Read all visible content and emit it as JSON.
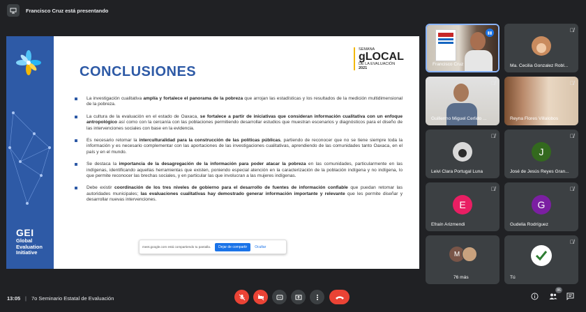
{
  "topbar": {
    "presenter": "Francisco Cruz está presentando"
  },
  "slide": {
    "title": "CONCLUSIONES",
    "brand": {
      "line1": "SEMANA",
      "line2": "gLOCAL",
      "line3": "DE LA EVALUACIÓN",
      "line4": "2021"
    },
    "logo": {
      "big": "GEI",
      "line1": "Global",
      "line2": "Evaluation",
      "line3": "Initiative"
    },
    "bullets": [
      {
        "a": "La investigación cualitativa ",
        "b": "amplía y fortalece el panorama de la pobreza",
        "c": " que arrojan las estadísticas y los resultados de la medición multidimensional de la pobreza.",
        "d": "",
        "e": ""
      },
      {
        "a": "La cultura de la evaluación en el estado de Oaxaca, ",
        "b": "se fortalece a partir de iniciativas que consideran información cualitativa con un enfoque antropológico",
        "c": " así como con la cercanía con las poblaciones permitiendo desarrollar estudios que muestran escenarios y diagnósticos para el diseño de las intervenciones sociales con base en la evidencia.",
        "d": "",
        "e": ""
      },
      {
        "a": "Es necesario retomar la ",
        "b": "interculturalidad para la construcción de las políticas públicas",
        "c": ", partiendo de reconocer que no se tiene siempre toda la información y es necesario complementar con las aportaciones de las investigaciones cualitativas, aprendiendo de las comunidades tanto Oaxaca, en el país y en el mundo.",
        "d": "",
        "e": ""
      },
      {
        "a": "Se destaca la ",
        "b": "importancia de la desagregación de la información para poder atacar la pobreza",
        "c": " en las comunidades, particularmente en las indígenas, identificando aquellas herramientas que existen, poniendo especial atención en la caracterización de la población indígena y no indígena, lo que permite reconocer las brechas sociales, y en particular las que involucran a las mujeres indígenas.",
        "d": "",
        "e": ""
      },
      {
        "a": "Debe existir ",
        "b": "coordinación de los tres niveles de gobierno para el desarrollo de fuentes de información confiable",
        "c": " que puedan retomar las autoridades municipales; ",
        "d": "las evaluaciones cualitativas hay demostrado generar información importante y relevante",
        "e": " que les permite diseñar y desarrollar nuevas intervenciones."
      }
    ],
    "share_bar": {
      "text": "meet.google.com está compartiendo tu pantalla.",
      "stop": "Dejar de compartir",
      "hide": "Ocultar"
    }
  },
  "participants": [
    {
      "name": "Francisco Cruz"
    },
    {
      "name": "Ma. Cecilia Gonzalez Robl..."
    },
    {
      "name": "Guillermo Miguel Cerlido ..."
    },
    {
      "name": "Reyna Flores Villalobos"
    },
    {
      "name": "Leivi Clara Portugal Luna"
    },
    {
      "name": "José de Jesús Reyes Gran...",
      "initial": "J"
    },
    {
      "name": "Efraín Arizmendi",
      "initial": "E"
    },
    {
      "name": "Gudelia Rodríguez",
      "initial": "G"
    },
    {
      "name": "76 más",
      "initial": "M"
    },
    {
      "name": "Tú"
    }
  ],
  "bottombar": {
    "time": "13:05",
    "separator": "|",
    "meeting": "7o Seminario Estatal de Evaluación",
    "participant_count": "86"
  },
  "colors": {
    "accent_blue": "#2e5aa6",
    "end_call_red": "#ea4335",
    "brand_yellow": "#f2b705"
  }
}
